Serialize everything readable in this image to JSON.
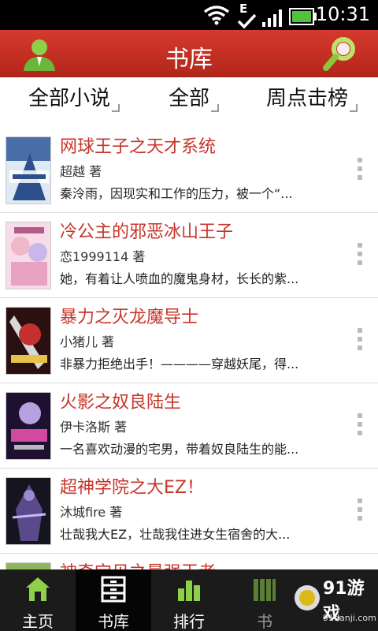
{
  "status": {
    "time": "10:31",
    "network": "E"
  },
  "header": {
    "title": "书库"
  },
  "filters": [
    {
      "label": "全部小说"
    },
    {
      "label": "全部"
    },
    {
      "label": "周点击榜"
    }
  ],
  "books": [
    {
      "title": "网球王子之天才系统",
      "author": "超越 著",
      "desc": "秦泠雨，因现实和工作的压力，被一个“..."
    },
    {
      "title": "冷公主的邪恶冰山王子",
      "author": "恋1999114 著",
      "desc": "她，有着让人喷血的魔鬼身材，长长的紫..."
    },
    {
      "title": "暴力之灭龙魔导士",
      "author": "小猪儿 著",
      "desc": "非暴力拒绝出手！————穿越妖尾，得..."
    },
    {
      "title": "火影之奴良陆生",
      "author": "伊卡洛斯 著",
      "desc": "一名喜欢动漫的宅男，带着奴良陆生的能..."
    },
    {
      "title": "超神学院之大EZ！",
      "author": "沐城fire 著",
      "desc": "壮哉我大EZ，壮哉我住进女生宿舍的大..."
    },
    {
      "title": "神奇宝贝之最强王者",
      "author": "",
      "desc": ""
    }
  ],
  "tabs": [
    {
      "label": "主页"
    },
    {
      "label": "书库"
    },
    {
      "label": "排行"
    },
    {
      "label": "书"
    }
  ],
  "watermark": {
    "text": "91游戏",
    "sub": "91danji.com"
  },
  "colors": {
    "accent": "#c8352a",
    "header": "#c8302a",
    "tabbar": "#1b1b1b"
  }
}
